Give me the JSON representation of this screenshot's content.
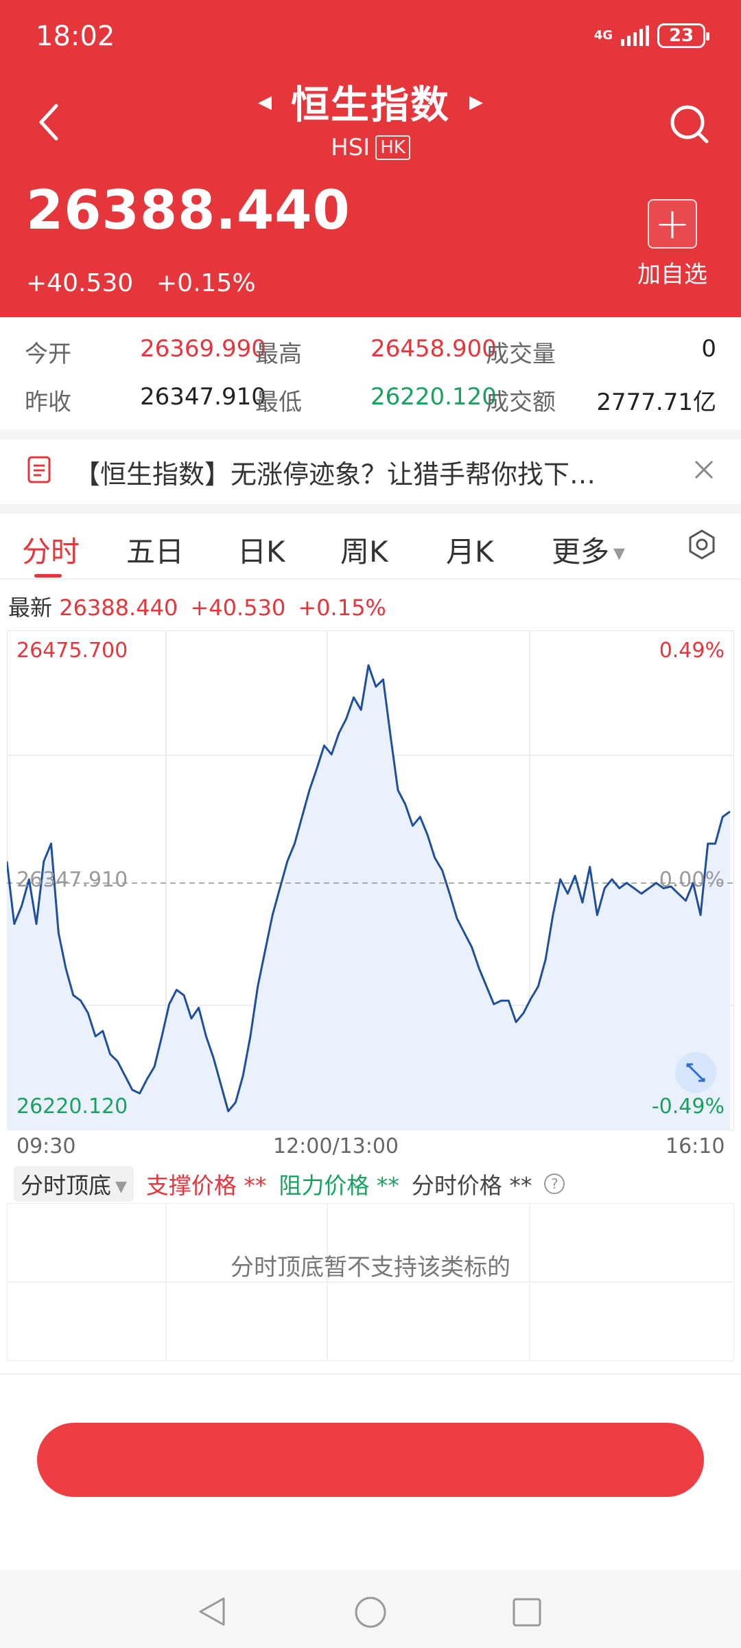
{
  "status": {
    "time": "18:02",
    "network": "4G",
    "battery": "23"
  },
  "header": {
    "title": "恒生指数",
    "code": "HSI",
    "market": "HK",
    "price": "26388.440",
    "change": "+40.530",
    "change_pct": "+0.15%",
    "add_label": "加自选",
    "color": "#e5363b"
  },
  "stats": {
    "open_label": "今开",
    "open": "26369.990",
    "high_label": "最高",
    "high": "26458.900",
    "volume_label": "成交量",
    "volume": "0",
    "prev_close_label": "昨收",
    "prev_close": "26347.910",
    "low_label": "最低",
    "low": "26220.120",
    "turnover_label": "成交额",
    "turnover": "2777.71亿"
  },
  "news": {
    "text": "【恒生指数】无涨停迹象？让猎手帮你找下…"
  },
  "tabs": [
    "分时",
    "五日",
    "日K",
    "周K",
    "月K",
    "更多"
  ],
  "latest": {
    "label": "最新",
    "price": "26388.440",
    "change": "+40.530",
    "pct": "+0.15%"
  },
  "chart_data": {
    "type": "line",
    "x_start": "09:30",
    "x_mid": "12:00/13:00",
    "x_end": "16:10",
    "ylim": [
      26220.12,
      26475.7
    ],
    "prev_close": 26347.91,
    "y_top_label": "26475.700",
    "y_bottom_label": "26220.120",
    "y_mid_label": "26347.910",
    "pct_top": "0.49%",
    "pct_mid": "0.00%",
    "pct_bottom": "-0.49%",
    "values": [
      26360,
      26325,
      26335,
      26350,
      26325,
      26360,
      26370,
      26320,
      26300,
      26285,
      26282,
      26275,
      26262,
      26265,
      26252,
      26248,
      26240,
      26232,
      26230,
      26238,
      26245,
      26262,
      26280,
      26288,
      26285,
      26272,
      26278,
      26262,
      26250,
      26235,
      26220,
      26225,
      26240,
      26262,
      26290,
      26310,
      26330,
      26345,
      26360,
      26370,
      26385,
      26400,
      26412,
      26425,
      26420,
      26432,
      26440,
      26452,
      26445,
      26470,
      26458,
      26462,
      26430,
      26400,
      26392,
      26380,
      26385,
      26375,
      26362,
      26355,
      26342,
      26328,
      26320,
      26312,
      26300,
      26290,
      26280,
      26282,
      26282,
      26270,
      26275,
      26283,
      26290,
      26305,
      26330,
      26350,
      26342,
      26352,
      26337,
      26357,
      26330,
      26345,
      26350,
      26345,
      26348,
      26345,
      26342,
      26345,
      26348,
      26345,
      26346,
      26342,
      26338,
      26348,
      26330,
      26370,
      26370,
      26385,
      26388
    ],
    "grid": true,
    "line_color": "#1e4f9e",
    "fill_color": "#eaf1fc"
  },
  "indicator": {
    "select": "分时顶底",
    "support_label": "支撑价格",
    "support_value": "**",
    "resist_label": "阻力价格",
    "resist_value": "**",
    "price_label": "分时价格",
    "price_value": "**",
    "help": "?",
    "empty": "分时顶底暂不支持该类标的"
  },
  "bottom_button": {
    "label": ""
  }
}
